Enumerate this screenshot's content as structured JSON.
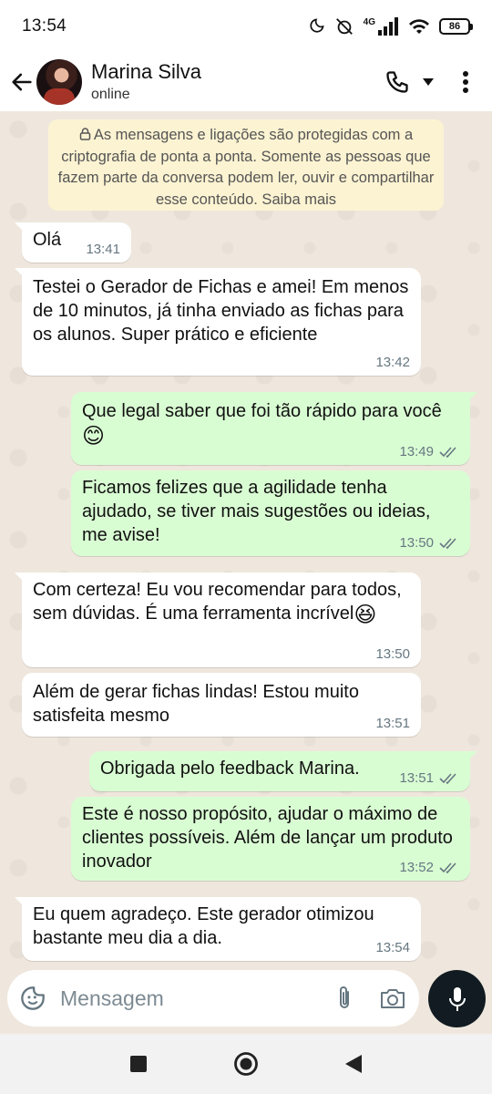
{
  "status_bar": {
    "time": "13:54",
    "network": "4G",
    "battery": "86"
  },
  "header": {
    "name": "Marina Silva",
    "status": "online"
  },
  "encryption_notice": "As mensagens e ligações são protegidas com a criptografia de ponta a ponta. Somente as pessoas que fazem parte da conversa podem ler, ouvir e compartilhar esse conteúdo. Saiba mais",
  "messages": [
    {
      "direction": "in",
      "text": "Olá",
      "time": "13:41"
    },
    {
      "direction": "in",
      "text": "Testei o Gerador de Fichas e amei! Em menos de 10 minutos, já tinha enviado as fichas para os alunos. Super prático e eficiente",
      "time": "13:42"
    },
    {
      "direction": "out",
      "text": "Que legal saber que foi tão rápido para você",
      "emoji": "😊",
      "time": "13:49"
    },
    {
      "direction": "out",
      "text": "Ficamos felizes que a agilidade tenha ajudado, se tiver mais sugestões ou ideias, me avise!",
      "time": "13:50"
    },
    {
      "direction": "in",
      "text": "Com certeza! Eu vou recomendar para todos, sem dúvidas. É uma ferramenta incrível",
      "emoji": "😆",
      "time": "13:50"
    },
    {
      "direction": "in",
      "text": "Além de gerar fichas lindas! Estou muito satisfeita mesmo",
      "time": "13:51"
    },
    {
      "direction": "out",
      "text": "Obrigada pelo feedback Marina.",
      "time": "13:51"
    },
    {
      "direction": "out",
      "text": "Este é nosso propósito, ajudar o máximo de clientes possíveis. Além de lançar um produto inovador",
      "time": "13:52"
    },
    {
      "direction": "in",
      "text": "Eu quem agradeço. Este gerador otimizou bastante meu dia a dia.",
      "time": "13:54"
    }
  ],
  "input": {
    "placeholder": "Mensagem"
  },
  "colors": {
    "incoming": "#ffffff",
    "outgoing": "#d9fdd3",
    "chat_bg": "#efe7dd",
    "notice_bg": "#fcf3d2"
  }
}
